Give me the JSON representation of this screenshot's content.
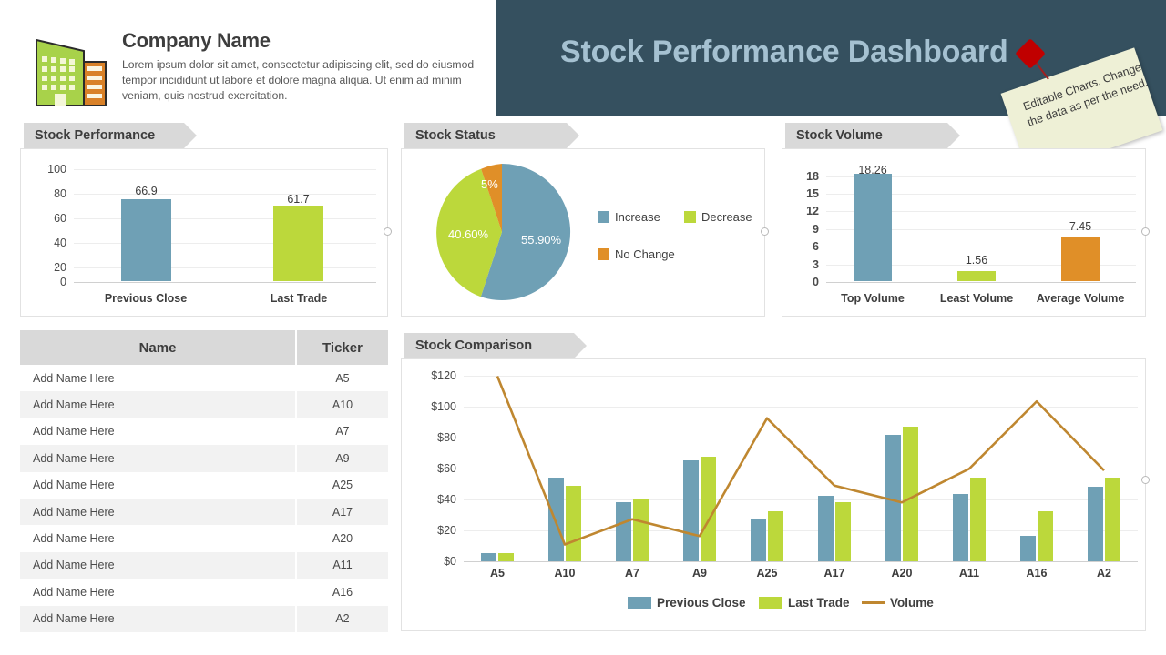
{
  "header": {
    "dashboard_title": "Stock Performance Dashboard",
    "company_name": "Company Name",
    "company_desc": "Lorem ipsum dolor sit amet, consectetur adipiscing elit, sed do eiusmod tempor incididunt ut labore et dolore magna aliqua. Ut enim ad minim veniam, quis nostrud exercitation.",
    "sticky_note": "Editable Charts. Change the data as per the need.",
    "logo_icon": "building-icon",
    "pin_icon": "pushpin-icon"
  },
  "colors": {
    "blue": "#6fa0b5",
    "green": "#bcd83b",
    "orange": "#e08f28",
    "navy": "#35505f",
    "title_text": "#a5c1d1",
    "tab_gray": "#d9d9d9",
    "note": "#eef0d6",
    "pin_red": "#c00000"
  },
  "panels": {
    "stock_performance": "Stock Performance",
    "stock_status": "Stock Status",
    "stock_volume": "Stock Volume",
    "stock_comparison": "Stock Comparison"
  },
  "table": {
    "columns": [
      "Name",
      "Ticker"
    ],
    "rows": [
      {
        "name": "Add Name Here",
        "ticker": "A5"
      },
      {
        "name": "Add Name Here",
        "ticker": "A10"
      },
      {
        "name": "Add Name Here",
        "ticker": "A7"
      },
      {
        "name": "Add Name Here",
        "ticker": "A9"
      },
      {
        "name": "Add Name Here",
        "ticker": "A25"
      },
      {
        "name": "Add Name Here",
        "ticker": "A17"
      },
      {
        "name": "Add Name Here",
        "ticker": "A20"
      },
      {
        "name": "Add Name Here",
        "ticker": "A11"
      },
      {
        "name": "Add Name Here",
        "ticker": "A16"
      },
      {
        "name": "Add Name Here",
        "ticker": "A2"
      }
    ]
  },
  "chart_data": [
    {
      "id": "stock_performance",
      "type": "bar",
      "title": "Stock Performance",
      "categories": [
        "Previous Close",
        "Last Trade"
      ],
      "values": [
        66.9,
        61.7
      ],
      "data_labels": [
        "66.9",
        "61.7"
      ],
      "colors": [
        "#6fa0b5",
        "#bcd83b"
      ],
      "ylim": [
        0,
        100
      ],
      "yticks": [
        0,
        20,
        40,
        60,
        80,
        100
      ],
      "ytick_labels": [
        "0",
        "20",
        "40",
        "60",
        "80",
        "100"
      ],
      "xlabel": "",
      "ylabel": "",
      "grid": true,
      "legend": "none"
    },
    {
      "id": "stock_status",
      "type": "pie",
      "title": "Stock Status",
      "categories": [
        "Increase",
        "Decrease",
        "No Change"
      ],
      "values": [
        55.9,
        40.6,
        5.0
      ],
      "data_labels": [
        "55.90%",
        "40.60%",
        "5%"
      ],
      "colors": [
        "#6fa0b5",
        "#bcd83b",
        "#e08f28"
      ],
      "legend": "right"
    },
    {
      "id": "stock_volume",
      "type": "bar",
      "title": "Stock Volume",
      "categories": [
        "Top Volume",
        "Least Volume",
        "Average Volume"
      ],
      "values": [
        18.26,
        1.56,
        7.45
      ],
      "data_labels": [
        "18.26",
        "1.56",
        "7.45"
      ],
      "colors": [
        "#6fa0b5",
        "#bcd83b",
        "#e08f28"
      ],
      "ylim": [
        0,
        19.5
      ],
      "yticks": [
        0,
        3,
        6,
        9,
        12,
        15,
        18
      ],
      "ytick_labels": [
        "0",
        "3",
        "6",
        "9",
        "12",
        "15",
        "18"
      ],
      "xlabel": "",
      "ylabel": "",
      "grid": true,
      "legend": "none"
    },
    {
      "id": "stock_comparison",
      "type": "bar+line",
      "title": "Stock Comparison",
      "categories": [
        "A5",
        "A10",
        "A7",
        "A9",
        "A25",
        "A17",
        "A20",
        "A11",
        "A16",
        "A2"
      ],
      "series": [
        {
          "name": "Previous Close",
          "type": "bar",
          "color": "#6fa0b5",
          "values": [
            5,
            49.5,
            35,
            60,
            25,
            39,
            75,
            40,
            15,
            44.5
          ]
        },
        {
          "name": "Last Trade",
          "type": "bar",
          "color": "#bcd83b",
          "values": [
            5,
            45,
            37.5,
            62,
            30,
            35,
            80,
            50,
            30,
            49.5
          ]
        },
        {
          "name": "Volume",
          "type": "line",
          "color": "#bf8730",
          "values": [
            110,
            10,
            25,
            15,
            85,
            45,
            35,
            55,
            95,
            54
          ]
        }
      ],
      "ylim": [
        0,
        120
      ],
      "yticks": [
        0,
        20,
        40,
        60,
        80,
        100,
        120
      ],
      "ytick_labels": [
        "$0",
        "$20",
        "$40",
        "$60",
        "$80",
        "$100",
        "$120"
      ],
      "xlabel": "",
      "ylabel": "",
      "grid": true,
      "legend": "bottom"
    }
  ]
}
